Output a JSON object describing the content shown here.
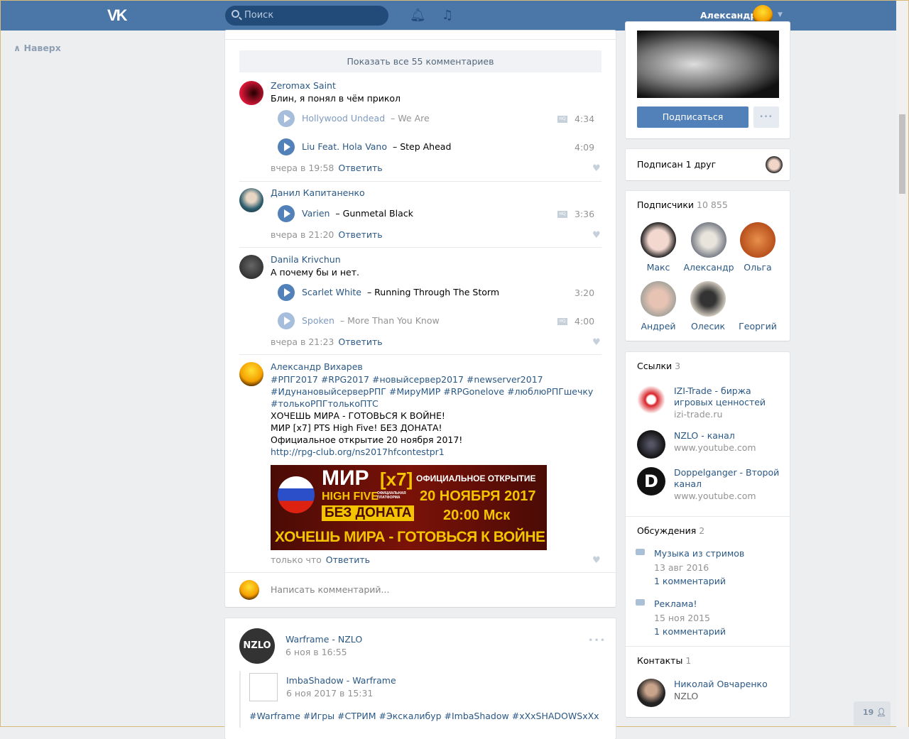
{
  "header": {
    "logo": "VK",
    "search_placeholder": "Поиск",
    "user_name": "Александр"
  },
  "left": {
    "up_label": "Наверх"
  },
  "comments": {
    "show_all": "Показать все 55 комментариев",
    "items": [
      {
        "author": "Zeromax Saint",
        "text": "Блин, я понял в чём прикол",
        "tracks": [
          {
            "artist": "Hollywood Undead",
            "title": "We Are",
            "duration": "4:34",
            "hq": "HQ"
          },
          {
            "artist": "Liu Feat. Hola Vano",
            "title": "Step Ahead",
            "duration": "4:09"
          }
        ],
        "time": "вчера в 19:58",
        "reply": "Ответить"
      },
      {
        "author": "Данил Капитаненко",
        "tracks": [
          {
            "artist": "Varien",
            "title": "Gunmetal Black",
            "duration": "3:36",
            "hq": "HQ"
          }
        ],
        "time": "вчера в 21:20",
        "reply": "Ответить"
      },
      {
        "author": "Danila Krivchun",
        "text": "А почему бы и нет.",
        "tracks": [
          {
            "artist": "Scarlet White",
            "title": "Running Through The Storm",
            "duration": "3:20"
          },
          {
            "artist": "Spoken",
            "title": "More Than You Know",
            "duration": "4:00",
            "hq": "HQ"
          }
        ],
        "time": "вчера в 21:23",
        "reply": "Ответить"
      },
      {
        "author": "Александр Вихарев",
        "hashtags": [
          "#РПГ2017 #RPG2017 #новыйсервер2017 #newserver2017",
          "#ИдунановыйсерверРПГ #МируМИР #RPGonelove #люблюРПГшечку",
          "#толькоРПГтолькоПТС"
        ],
        "lines": [
          "ХОЧЕШЬ МИРА - ГОТОВЬСЯ К ВОЙНЕ!",
          "МИР [x7] PTS High Five! БЕЗ ДОНАТА!",
          "Официальное открытие 20 ноября 2017!"
        ],
        "link": "http://rpg-club.org/ns2017hfcontestpr1",
        "banner": {
          "l1": "МИР",
          "l2": "[x7]",
          "l3": "HIGH FIVE",
          "l4": "ОФИЦИАЛЬНАЯ ПЛАТФОРМА",
          "l5": "БЕЗ ДОНАТА",
          "r1": "ОФИЦИАЛЬНОЕ ОТКРЫТИЕ",
          "r2": "20 НОЯБРЯ 2017",
          "r3": "20:00 Мск",
          "bottom": "ХОЧЕШЬ МИРА - ГОТОВЬСЯ К ВОЙНЕ"
        },
        "time": "только что",
        "reply": "Ответить"
      }
    ],
    "input_placeholder": "Написать комментарий..."
  },
  "post": {
    "author": "Warframe - NZLO",
    "avatar_text": "NZLO",
    "time": "6 ноя в 16:55",
    "repost_author": "ImbaShadow - Warframe",
    "repost_time": "6 ноя 2017 в 15:31",
    "text": "#Warframe #Игры #СТРИМ #Экскалибур #ImbaShadow #xXxSHADOWSxXx"
  },
  "right": {
    "subscribe": "Подписаться",
    "friends_label": "Подписан 1 друг",
    "subscribers": {
      "title": "Подписчики",
      "count": "10 855",
      "items": [
        "Макс",
        "Александр",
        "Ольга",
        "Андрей",
        "Олесик",
        "Георгий"
      ]
    },
    "links": {
      "title": "Ссылки",
      "count": "3",
      "items": [
        {
          "title": "IZI-Trade - биржа игровых ценностей",
          "url": "izi-trade.ru"
        },
        {
          "title": "NZLO - канал",
          "url": "www.youtube.com"
        },
        {
          "title": "Doppelganger - Второй канал",
          "url": "www.youtube.com"
        }
      ]
    },
    "discussions": {
      "title": "Обсуждения",
      "count": "2",
      "items": [
        {
          "title": "Музыка из стримов",
          "date": "13 авг 2016",
          "comments": "1 комментарий"
        },
        {
          "title": "Реклама!",
          "date": "15 ноя 2015",
          "comments": "1 комментарий"
        }
      ]
    },
    "contacts": {
      "title": "Контакты",
      "count": "1",
      "items": [
        {
          "name": "Николай Овчаренко",
          "role": "NZLO"
        }
      ]
    }
  },
  "badge": {
    "count": "19"
  }
}
